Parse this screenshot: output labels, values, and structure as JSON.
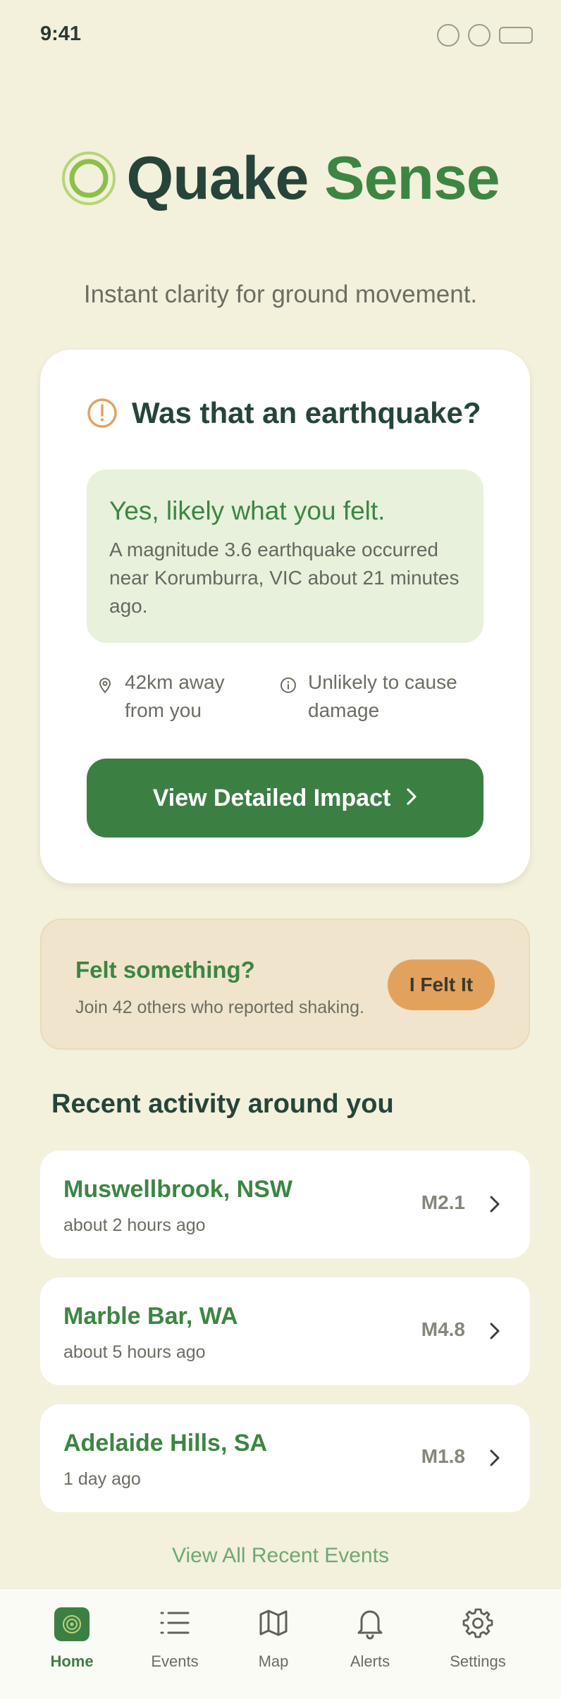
{
  "status_bar": {
    "time": "9:41"
  },
  "header": {
    "title_part1": "Quake",
    "title_part2": "Sense",
    "tagline": "Instant clarity for ground movement."
  },
  "colors": {
    "brand_dark": "#26443a",
    "brand_green": "#3d8543",
    "accent_orange": "#e2a25e",
    "background": "#f3f0dc"
  },
  "main_card": {
    "title": "Was that an earthquake?",
    "answer_title": "Yes, likely what you felt.",
    "answer_body": "A magnitude 3.6 earthquake occurred near Korumburra, VIC about 21 minutes ago.",
    "distance": "42km away from you",
    "damage": "Unlikely to cause damage",
    "button_label": "View Detailed Impact"
  },
  "felt_banner": {
    "title": "Felt something?",
    "subtitle": "Join 42 others who reported shaking.",
    "button_label": "I Felt It"
  },
  "recent": {
    "title": "Recent activity around you",
    "events": [
      {
        "place": "Muswellbrook, NSW",
        "time": "about 2 hours ago",
        "magnitude": "M2.1"
      },
      {
        "place": "Marble Bar, WA",
        "time": "about 5 hours ago",
        "magnitude": "M4.8"
      },
      {
        "place": "Adelaide Hills, SA",
        "time": "1 day ago",
        "magnitude": "M1.8"
      }
    ],
    "view_all": "View All Recent Events"
  },
  "nav": {
    "items": [
      {
        "label": "Home",
        "icon": "target-icon",
        "active": true
      },
      {
        "label": "Events",
        "icon": "list-icon",
        "active": false
      },
      {
        "label": "Map",
        "icon": "map-icon",
        "active": false
      },
      {
        "label": "Alerts",
        "icon": "bell-icon",
        "active": false
      },
      {
        "label": "Settings",
        "icon": "gear-icon",
        "active": false
      }
    ]
  }
}
